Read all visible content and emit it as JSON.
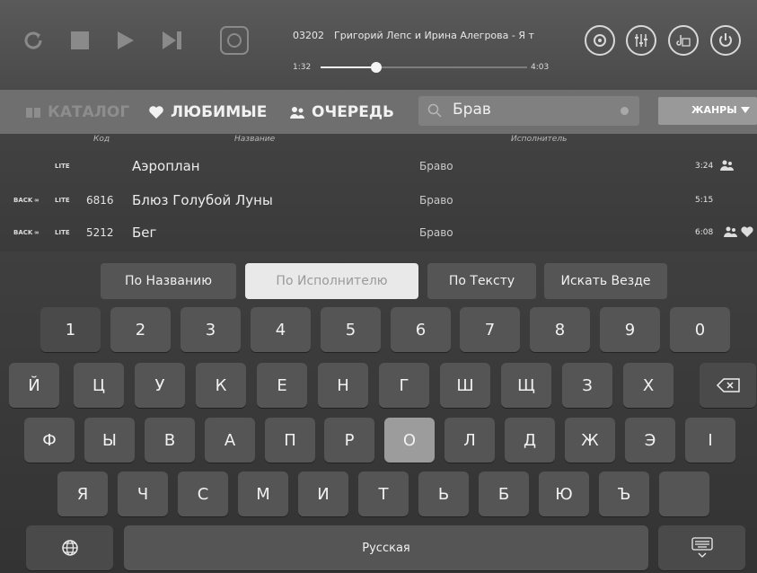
{
  "player": {
    "track_number": "03202",
    "track_title": "Григорий Лепс и Ирина Алегрова - Я т",
    "time_elapsed": "1:32",
    "time_total": "4:03",
    "progress": 0.27
  },
  "nav": {
    "catalog": "КАТАЛОГ",
    "favorites": "ЛЮБИМЫЕ",
    "queue": "ОЧЕРЕДЬ",
    "search_value": "Брав",
    "genres": "ЖАНРЫ"
  },
  "table": {
    "headers": {
      "code": "Код",
      "name": "Название",
      "artist": "Исполнитель"
    },
    "rows": [
      {
        "code": "",
        "name": "Аэроплан",
        "artist": "Браво",
        "duration": "3:24"
      },
      {
        "code": "6816",
        "name": "Блюз Голубой Луны",
        "artist": "Браво",
        "duration": "5:15"
      },
      {
        "code": "5212",
        "name": "Бег",
        "artist": "Браво",
        "duration": "6:08"
      }
    ]
  },
  "search_modes": {
    "by_name": "По Названию",
    "by_artist": "По Исполнителю",
    "by_text": "По Тексту",
    "everywhere": "Искать Везде"
  },
  "keyboard": {
    "row_digits": [
      "1",
      "2",
      "3",
      "4",
      "5",
      "6",
      "7",
      "8",
      "9",
      "0"
    ],
    "row1": [
      "Й",
      "Ц",
      "У",
      "К",
      "Е",
      "Н",
      "Г",
      "Ш",
      "Щ",
      "З",
      "Х"
    ],
    "row2": [
      "Ф",
      "Ы",
      "В",
      "А",
      "П",
      "Р",
      "О",
      "Л",
      "Д",
      "Ж",
      "Э",
      "І"
    ],
    "row3": [
      "Я",
      "Ч",
      "С",
      "М",
      "И",
      "Т",
      "Ь",
      "Б",
      "Ю",
      "Ъ"
    ],
    "space_label": "Русская"
  }
}
